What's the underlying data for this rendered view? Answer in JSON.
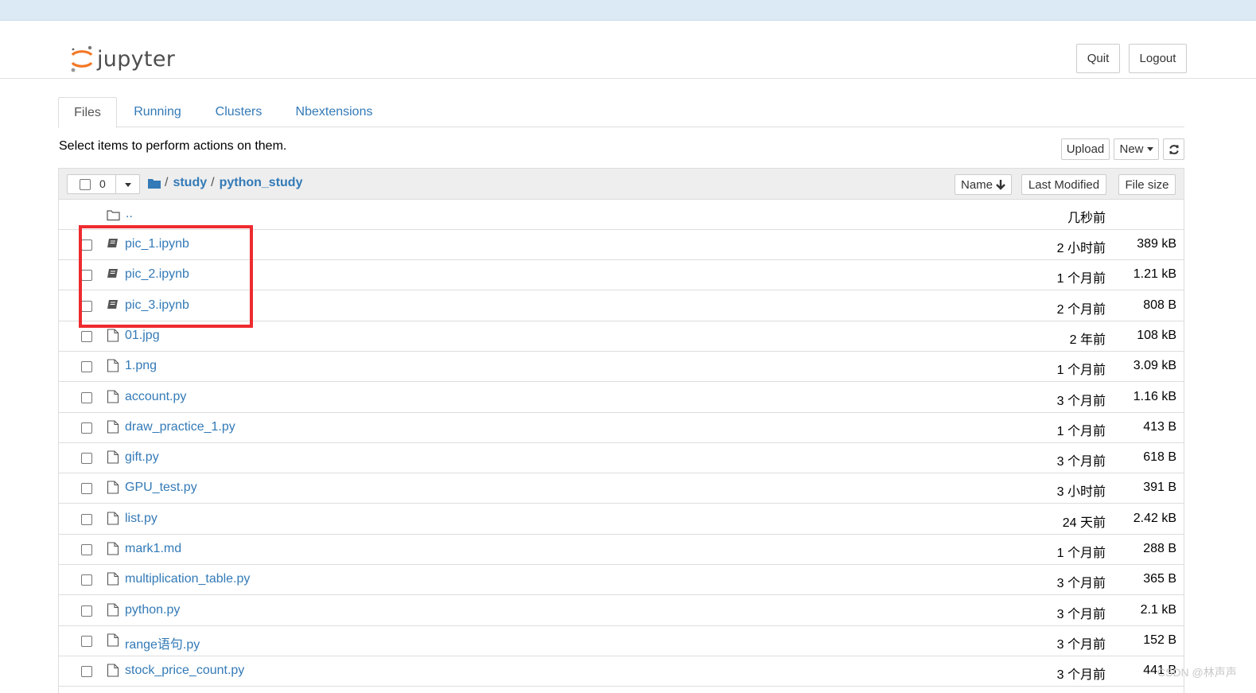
{
  "header": {
    "logo_text": "jupyter",
    "quit_label": "Quit",
    "logout_label": "Logout"
  },
  "tabs": [
    {
      "label": "Files",
      "active": true
    },
    {
      "label": "Running",
      "active": false
    },
    {
      "label": "Clusters",
      "active": false
    },
    {
      "label": "Nbextensions",
      "active": false
    }
  ],
  "toolbar": {
    "hint": "Select items to perform actions on them.",
    "upload_label": "Upload",
    "new_label": "New",
    "refresh_icon": "refresh-icon"
  },
  "list_header": {
    "selected_count": "0",
    "breadcrumb_root_icon": "folder-icon",
    "breadcrumb_sep": "/",
    "breadcrumb": [
      "study",
      "python_study"
    ],
    "sort_name": "Name",
    "sort_modified": "Last Modified",
    "sort_size": "File size"
  },
  "parent_row": {
    "name": "..",
    "modified": "几秒前"
  },
  "files": [
    {
      "name": "pic_1.ipynb",
      "type": "notebook",
      "modified": "2 小时前",
      "size": "389 kB"
    },
    {
      "name": "pic_2.ipynb",
      "type": "notebook",
      "modified": "1 个月前",
      "size": "1.21 kB"
    },
    {
      "name": "pic_3.ipynb",
      "type": "notebook",
      "modified": "2 个月前",
      "size": "808 B"
    },
    {
      "name": "01.jpg",
      "type": "file",
      "modified": "2 年前",
      "size": "108 kB"
    },
    {
      "name": "1.png",
      "type": "file",
      "modified": "1 个月前",
      "size": "3.09 kB"
    },
    {
      "name": "account.py",
      "type": "file",
      "modified": "3 个月前",
      "size": "1.16 kB"
    },
    {
      "name": "draw_practice_1.py",
      "type": "file",
      "modified": "1 个月前",
      "size": "413 B"
    },
    {
      "name": "gift.py",
      "type": "file",
      "modified": "3 个月前",
      "size": "618 B"
    },
    {
      "name": "GPU_test.py",
      "type": "file",
      "modified": "3 小时前",
      "size": "391 B"
    },
    {
      "name": "list.py",
      "type": "file",
      "modified": "24 天前",
      "size": "2.42 kB"
    },
    {
      "name": "mark1.md",
      "type": "file",
      "modified": "1 个月前",
      "size": "288 B"
    },
    {
      "name": "multiplication_table.py",
      "type": "file",
      "modified": "3 个月前",
      "size": "365 B"
    },
    {
      "name": "python.py",
      "type": "file",
      "modified": "3 个月前",
      "size": "2.1 kB"
    },
    {
      "name": "range语句.py",
      "type": "file",
      "modified": "3 个月前",
      "size": "152 B"
    },
    {
      "name": "stock_price_count.py",
      "type": "file",
      "modified": "3 个月前",
      "size": "441 B"
    }
  ],
  "watermark": "CSDN @林声声",
  "colors": {
    "link": "#337ab7",
    "highlight": "#ee2b2f",
    "topstrip": "#dbeaf5"
  }
}
